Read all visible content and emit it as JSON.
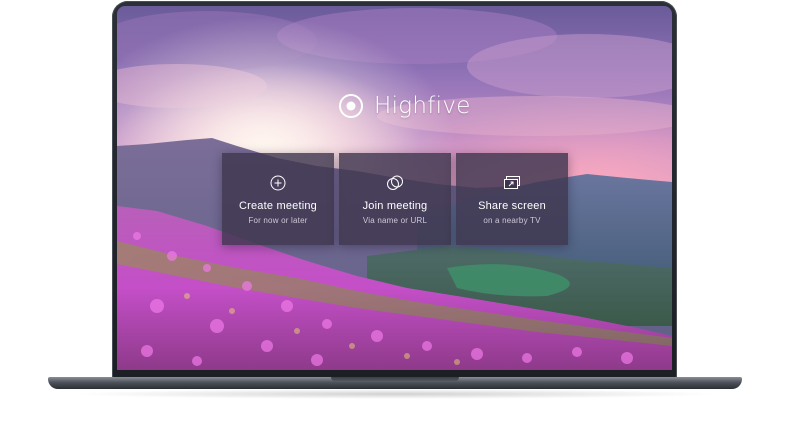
{
  "app": {
    "name": "Highfive"
  },
  "actions": [
    {
      "title": "Create meeting",
      "subtitle": "For now or later",
      "icon": "plus-circle-icon"
    },
    {
      "title": "Join meeting",
      "subtitle": "Via name or URL",
      "icon": "overlapping-circles-icon"
    },
    {
      "title": "Share screen",
      "subtitle": "on a nearby TV",
      "icon": "share-screen-icon"
    }
  ],
  "colors": {
    "card_background": "#3e364e",
    "text_primary": "#ffffff",
    "text_secondary": "#cfc8d8",
    "sky_top": "#6a5b9a",
    "flowers": "#d24fd8"
  }
}
